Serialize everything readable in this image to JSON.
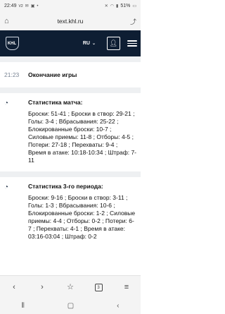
{
  "status_bar": {
    "time": "22:49",
    "carrier": "V2",
    "battery": "51%",
    "icons_left": [
      "message-icon",
      "signal-icon",
      "image-icon",
      "dot-icon"
    ],
    "icons_right": [
      "mute-icon",
      "wifi-icon",
      "signal-bars-icon",
      "battery-icon"
    ]
  },
  "browser": {
    "url": "text.khl.ru"
  },
  "header": {
    "logo_text": "KHL",
    "logo_tagline": "ЛИГА ЧЕМПИОНОВ",
    "lang": "RU"
  },
  "feed": {
    "events": [
      {
        "time": "21:23",
        "text": "Окончание игры"
      }
    ],
    "stats": [
      {
        "title": "Статистика матча:",
        "text": "Броски: 51-41 ; Броски в створ: 29-21 ; Голы: 3-4 ; Вбрасывания: 25-22 ; Блокированные броски: 10-7 ; Силовые приемы: 11-8 ; Отборы: 4-5 ; Потери: 27-18 ; Перехваты: 9-4 ; Время в атаке: 10:18-10:34 ; Штраф: 7-11"
      },
      {
        "title": "Статистика 3-го периода:",
        "text": "Броски: 9-16 ; Броски в створ: 3-11 ; Голы: 1-3 ; Вбрасывания: 10-6 ; Блокированные броски: 1-2 ; Силовые приемы: 4-4 ; Отборы: 0-2 ; Потери: 6-7 ; Перехваты: 4-1 ; Время в атаке: 03:16-03:04 ; Штраф: 0-2"
      }
    ]
  },
  "bottom_nav": {
    "tab_count": "3"
  }
}
